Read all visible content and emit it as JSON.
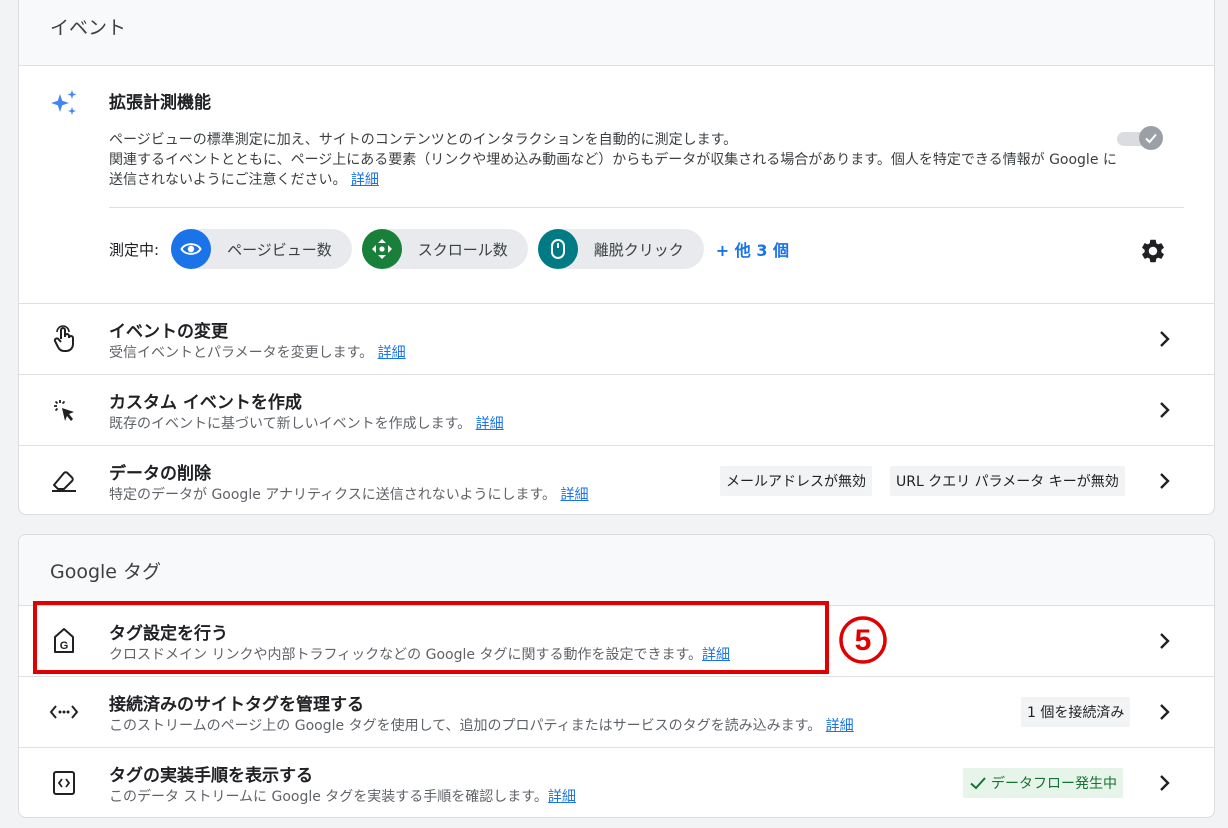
{
  "events_section": {
    "title": "イベント",
    "enhanced": {
      "title": "拡張計測機能",
      "desc_line1": "ページビューの標準測定に加え、サイトのコンテンツとのインタラクションを自動的に測定します。",
      "desc_line2": "関連するイベントとともに、ページ上にある要素（リンクや埋め込み動画など）からもデータが収集される場合があります。個人を特定できる情報が Google に送信されないようにご注意ください。",
      "link": "詳細",
      "toggle_on": true,
      "measuring_label": "測定中:",
      "chips": [
        {
          "label": "ページビュー数",
          "icon": "eye-icon",
          "color": "#1a73e8"
        },
        {
          "label": "スクロール数",
          "icon": "scroll-icon",
          "color": "#188038"
        },
        {
          "label": "離脱クリック",
          "icon": "mouse-icon",
          "color": "#007b83"
        }
      ],
      "more": "+ 他 3 個"
    },
    "rows": [
      {
        "title": "イベントの変更",
        "desc": "受信イベントとパラメータを変更します。",
        "link": "詳細",
        "icon": "touch-icon"
      },
      {
        "title": "カスタム イベントを作成",
        "desc": "既存のイベントに基づいて新しいイベントを作成します。",
        "link": "詳細",
        "icon": "cursor-click-icon"
      },
      {
        "title": "データの削除",
        "desc": "特定のデータが Google アナリティクスに送信されないようにします。",
        "link": "詳細",
        "icon": "eraser-icon",
        "badges": [
          "メールアドレスが無効",
          "URL クエリ パラメータ キーが無効"
        ]
      }
    ]
  },
  "tags_section": {
    "title": "Google タグ",
    "rows": [
      {
        "title": "タグ設定を行う",
        "desc": "クロスドメイン リンクや内部トラフィックなどの Google タグに関する動作を設定できます。",
        "link": "詳細",
        "icon": "google-tag-icon"
      },
      {
        "title": "接続済みのサイトタグを管理する",
        "desc": "このストリームのページ上の Google タグを使用して、追加のプロパティまたはサービスのタグを読み込みます。",
        "link": "詳細",
        "icon": "code-arrows-icon",
        "badge": "1 個を接続済み"
      },
      {
        "title": "タグの実装手順を表示する",
        "desc": "このデータ ストリームに Google タグを実装する手順を確認します。",
        "link": "詳細",
        "icon": "code-tag-icon",
        "badge": "データフロー発生中"
      }
    ]
  },
  "annotation": {
    "step": "5",
    "color": "#e00000"
  }
}
